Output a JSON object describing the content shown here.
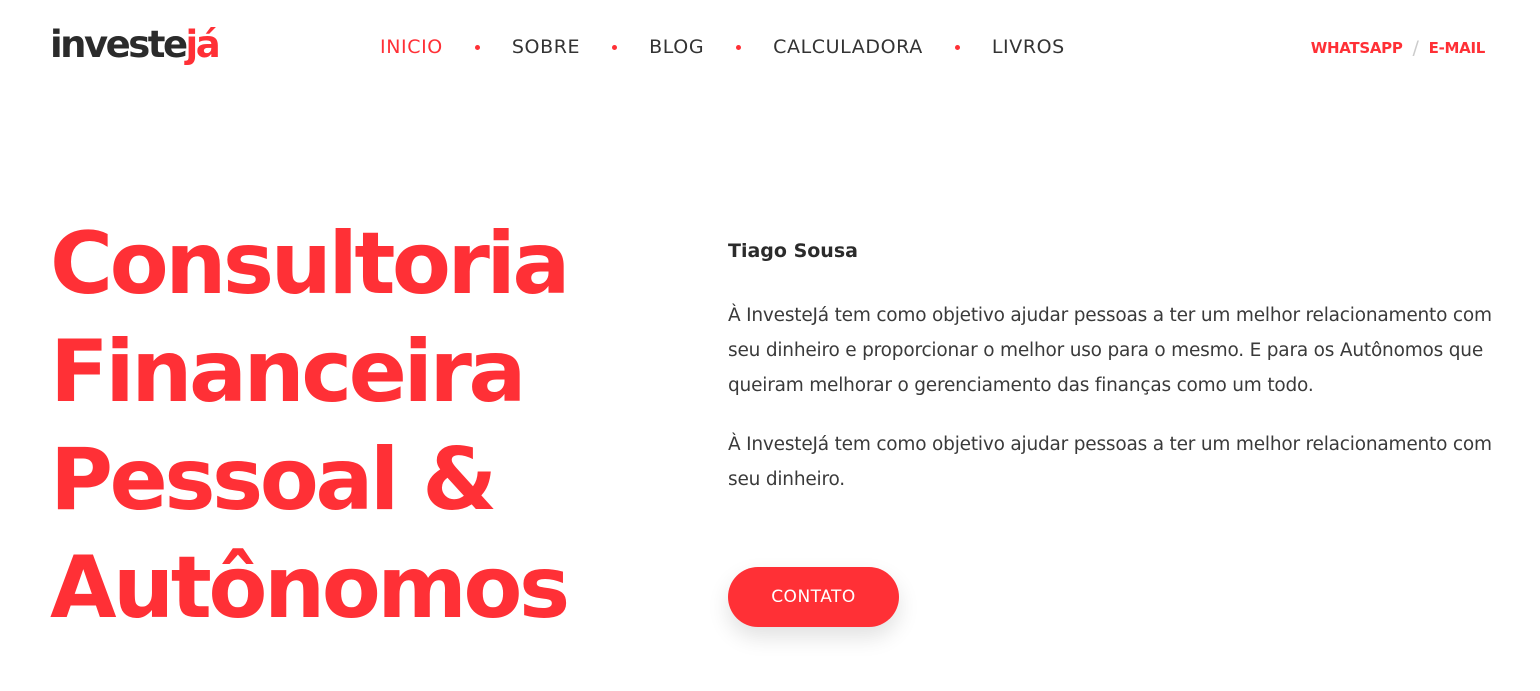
{
  "logo": {
    "part1": "investe",
    "part2": "já"
  },
  "nav": {
    "items": [
      {
        "label": "INICIO"
      },
      {
        "label": "SOBRE"
      },
      {
        "label": "BLOG"
      },
      {
        "label": "CALCULADORA"
      },
      {
        "label": "LIVROS"
      }
    ],
    "active_index": 0
  },
  "contact_links": {
    "whatsapp": "WHATSAPP",
    "separator": "/",
    "email": "E-MAIL"
  },
  "hero": {
    "title_lines": [
      "Consultoria",
      "Financeira",
      "Pessoal &",
      "Autônomos"
    ],
    "author": "Tiago Sousa",
    "paragraphs": [
      "À InvesteJá tem como objetivo ajudar pessoas a ter um melhor relacionamento com seu dinheiro e proporcionar o melhor uso para o mesmo. E para os Autônomos que queiram melhorar o gerenciamento das finanças como um todo.",
      "À InvesteJá tem como objetivo ajudar pessoas a ter um melhor relacionamento com seu dinheiro."
    ],
    "cta_label": "CONTATO"
  },
  "colors": {
    "accent": "#ff3036",
    "text_dark": "#2b2b2b",
    "text_body": "#3a3a3a",
    "background": "#ffffff"
  }
}
